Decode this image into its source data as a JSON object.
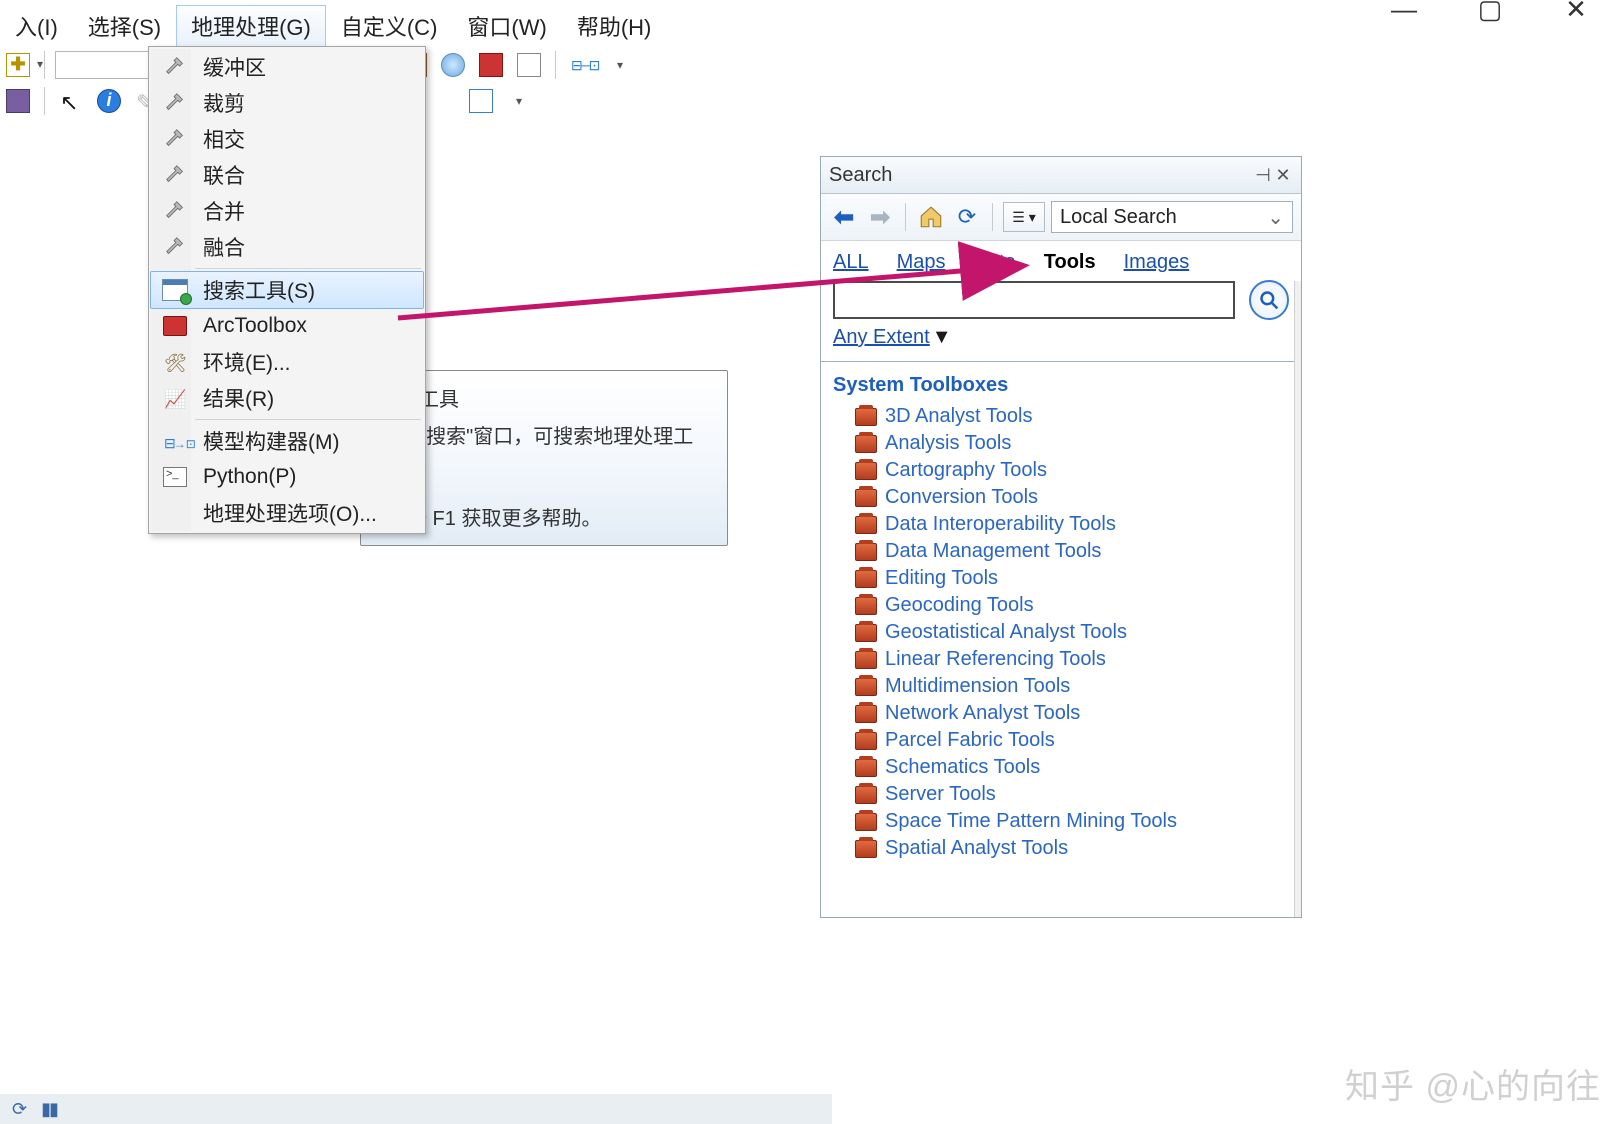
{
  "window_controls": {
    "min": "—",
    "max": "▢",
    "close": "✕"
  },
  "menubar": {
    "items": [
      {
        "label": "入(I)"
      },
      {
        "label": "选择(S)"
      },
      {
        "label": "地理处理(G)",
        "active": true
      },
      {
        "label": "自定义(C)"
      },
      {
        "label": "窗口(W)"
      },
      {
        "label": "帮助(H)"
      }
    ]
  },
  "dropdown": {
    "items": [
      {
        "icon": "hammer",
        "label": "缓冲区"
      },
      {
        "icon": "hammer",
        "label": "裁剪"
      },
      {
        "icon": "hammer",
        "label": "相交"
      },
      {
        "icon": "hammer",
        "label": "联合"
      },
      {
        "icon": "hammer",
        "label": "合并"
      },
      {
        "icon": "hammer",
        "label": "融合"
      },
      {
        "sep": true
      },
      {
        "icon": "searchwin",
        "label": "搜索工具(S)",
        "highlight": true
      },
      {
        "icon": "arctoolbox",
        "label": "ArcToolbox"
      },
      {
        "icon": "env",
        "label": "环境(E)..."
      },
      {
        "icon": "results",
        "label": "结果(R)"
      },
      {
        "sep": true
      },
      {
        "icon": "model",
        "label": "模型构建器(M)"
      },
      {
        "icon": "python",
        "label": "Python(P)"
      },
      {
        "icon": "",
        "label": "地理处理选项(O)..."
      }
    ]
  },
  "tooltip": {
    "title": "搜索工具",
    "body": "打开\"搜索\"窗口，可搜索地理处理工具。",
    "help_hint": "按 F1 获取更多帮助。"
  },
  "search": {
    "title": "Search",
    "combo": "Local Search",
    "tabs": [
      "ALL",
      "Maps",
      "Data",
      "Tools",
      "Images"
    ],
    "active_tab": "Tools",
    "input_value": "",
    "extent_label": "Any Extent",
    "heading": "System Toolboxes",
    "toolboxes": [
      "3D Analyst Tools",
      "Analysis Tools",
      "Cartography Tools",
      "Conversion Tools",
      "Data Interoperability Tools",
      "Data Management Tools",
      "Editing Tools",
      "Geocoding Tools",
      "Geostatistical Analyst Tools",
      "Linear Referencing Tools",
      "Multidimension Tools",
      "Network Analyst Tools",
      "Parcel Fabric Tools",
      "Schematics Tools",
      "Server Tools",
      "Space Time Pattern Mining Tools",
      "Spatial Analyst Tools"
    ]
  },
  "watermark": "知乎 @心的向往"
}
